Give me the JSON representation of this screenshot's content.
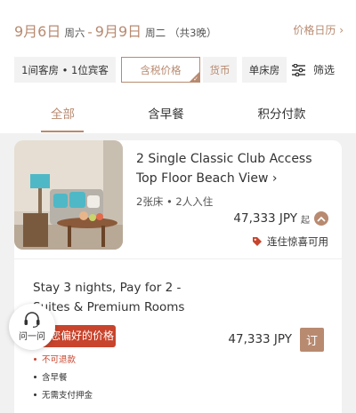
{
  "header": {
    "checkin_date": "9月6日",
    "checkin_weekday": "周六",
    "separator": "-",
    "checkout_date": "9月9日",
    "checkout_weekday": "周二",
    "nights": "（共3晚）",
    "calendar_link": "价格日历 ›"
  },
  "filters": {
    "guests": "1间客房 • 1位宾客",
    "tax_incl": "含税价格",
    "currency": "货币",
    "bed_type": "单床房",
    "filter_label": "筛选"
  },
  "tabs": [
    "全部",
    "含早餐",
    "积分付款"
  ],
  "room": {
    "title": "2 Single Classic Club Access Top Floor Beach View ›",
    "meta": "2张床 • 2人入住",
    "price": "47,333 JPY",
    "price_suffix": "起",
    "promo": "连住惊喜可用"
  },
  "rate": {
    "title": "Stay 3 nights, Pay for 2 - Suites & Premium Rooms",
    "tag": "您偏好的价格",
    "price": "47,333 JPY",
    "book_label": "订",
    "conditions": [
      "不可退款",
      "含早餐",
      "无需支付押金"
    ]
  },
  "help": {
    "label": "问一问"
  },
  "colors": {
    "accent": "#b88a70",
    "alert": "#c8442c"
  }
}
